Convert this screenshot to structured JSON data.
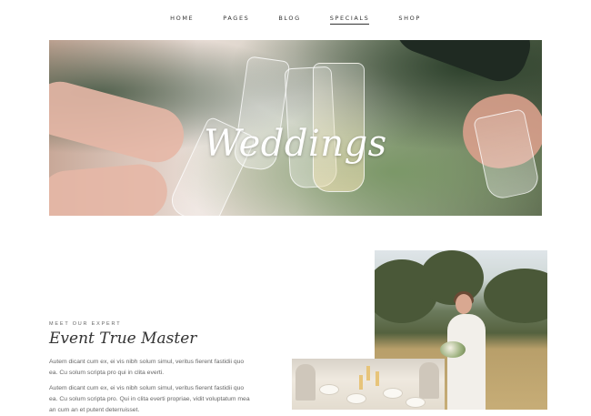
{
  "nav": {
    "items": [
      {
        "label": "HOME"
      },
      {
        "label": "PAGES"
      },
      {
        "label": "BLOG"
      },
      {
        "label": "SPECIALS"
      },
      {
        "label": "SHOP"
      }
    ],
    "active": "SPECIALS"
  },
  "hero": {
    "title": "Weddings"
  },
  "expert": {
    "eyebrow": "MEET OUR EXPERT",
    "title": "Event True Master",
    "paragraph1": "Autem dicant cum ex, ei vis nibh solum simul, veritus fierent fastidii quo ea. Cu solum scripta pro qui in clita everti.",
    "paragraph2": "Autem dicant cum ex, ei vis nibh solum simul, veritus fierent fastidii quo ea. Cu solum scripta pro. Qui in clita everti propriae, vidit voluptatum mea an cum an et putent deterruisset."
  },
  "colors": {
    "text": "#333333",
    "muted": "#666666",
    "hero_title": "#ffffff"
  }
}
